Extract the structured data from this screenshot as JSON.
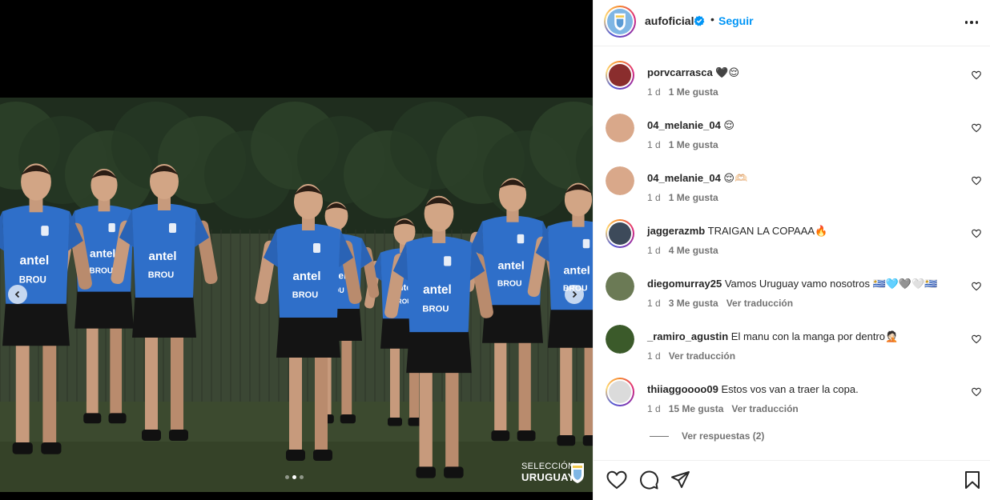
{
  "post": {
    "watermark_line1": "SELECCIÓN",
    "watermark_line2": "URUGUAYA",
    "jersey_sponsor": "antel",
    "jersey_sponsor2": "BROU"
  },
  "header": {
    "username": "aufoficial",
    "separator": "•",
    "follow_label": "Seguir"
  },
  "comments": [
    {
      "user": "porvcarrasca",
      "text": "🖤😌",
      "time": "1 d",
      "likes": "1 Me gusta",
      "translate": "",
      "ring": true,
      "avatar_color": "#8a2d2d"
    },
    {
      "user": "04_melanie_04",
      "text": "😌",
      "time": "1 d",
      "likes": "1 Me gusta",
      "translate": "",
      "ring": false,
      "avatar_color": "#d9a88a"
    },
    {
      "user": "04_melanie_04",
      "text": "😌🫶🏻",
      "time": "1 d",
      "likes": "1 Me gusta",
      "translate": "",
      "ring": false,
      "avatar_color": "#d9a88a"
    },
    {
      "user": "jaggerazmb",
      "text": "TRAIGAN LA COPAAA🔥",
      "time": "1 d",
      "likes": "4 Me gusta",
      "translate": "",
      "ring": true,
      "avatar_color": "#3d4a5a"
    },
    {
      "user": "diegomurray25",
      "text": "Vamos Uruguay vamo nosotros 🇺🇾🩵🩶🤍🇺🇾",
      "time": "1 d",
      "likes": "3 Me gusta",
      "translate": "Ver traducción",
      "ring": false,
      "avatar_color": "#6b7a55"
    },
    {
      "user": "_ramiro_agustin",
      "text": "El manu con la manga por dentro🤦🏻",
      "time": "1 d",
      "likes": "",
      "translate": "Ver traducción",
      "ring": false,
      "avatar_color": "#3b5a2a"
    },
    {
      "user": "thiiaggoooo09",
      "text": "Estos vos van a traer la copa.",
      "time": "1 d",
      "likes": "15 Me gusta",
      "translate": "Ver traducción",
      "ring": true,
      "avatar_color": "#dbdbdb"
    }
  ],
  "view_replies": "Ver respuestas (2)",
  "colors": {
    "accent": "#0095f6",
    "text": "#262626",
    "muted": "#737373",
    "verified": "#0095f6"
  },
  "icons": [
    "heart-icon",
    "comment-icon",
    "share-icon",
    "bookmark-icon",
    "more-icon",
    "verified-badge-icon",
    "chevron-left-icon",
    "chevron-right-icon"
  ]
}
